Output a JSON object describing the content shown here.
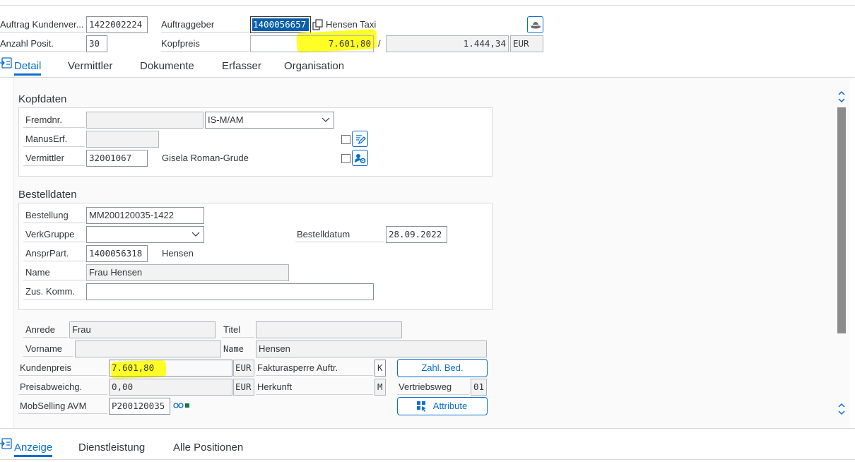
{
  "header": {
    "auftrag_label": "Auftrag Kundenver...",
    "auftrag_value": "1422002224",
    "auftraggeber_label": "Auftraggeber",
    "auftraggeber_value": "1400056657",
    "auftraggeber_name": "Hensen Taxi",
    "anzahl_label": "Anzahl Posit.",
    "anzahl_value": "30",
    "kopfpreis_label": "Kopfpreis",
    "kopfpreis_value": "7.601,80",
    "separator": "/",
    "kopfpreis2_value": "1.444,34",
    "currency": "EUR"
  },
  "tabs_top": [
    {
      "label": "Detail"
    },
    {
      "label": "Vermittler"
    },
    {
      "label": "Dokumente"
    },
    {
      "label": "Erfasser"
    },
    {
      "label": "Organisation"
    }
  ],
  "kopfdaten": {
    "title": "Kopfdaten",
    "fremdnr_label": "Fremdnr.",
    "fremdnr_value": "",
    "fremdnr_select": "IS-M/AM",
    "manuserf_label": "ManusErf.",
    "manuserf_value": "",
    "vermittler_label": "Vermittler",
    "vermittler_value": "32001067",
    "vermittler_name": "Gisela Roman-Grude"
  },
  "bestelldaten": {
    "title": "Bestelldaten",
    "bestellung_label": "Bestellung",
    "bestellung_value": "MM200120035-1422",
    "verkgruppe_label": "VerkGruppe",
    "verkgruppe_value": "",
    "bestelldatum_label": "Bestelldatum",
    "bestelldatum_value": "28.09.2022",
    "ansprpart_label": "AnsprPart.",
    "ansprpart_value": "1400056318",
    "ansprpart_name": "Hensen",
    "name_label": "Name",
    "name_value": "Frau Hensen",
    "zuskomm_label": "Zus. Komm.",
    "zuskomm_value": ""
  },
  "personal": {
    "anrede_label": "Anrede",
    "anrede_value": "Frau",
    "titel_label": "Titel",
    "titel_value": "",
    "vorname_label": "Vorname",
    "vorname_value": "",
    "name_label": "Name",
    "name_value": "Hensen",
    "kundenpreis_label": "Kundenpreis",
    "kundenpreis_value": "7.601,80",
    "kundenpreis_currency": "EUR",
    "fakturasperre_label": "Fakturasperre Auftr.",
    "fakturasperre_value": "K",
    "zahl_button": "Zahl. Bed.",
    "preisabw_label": "Preisabweichg.",
    "preisabw_value": "0,00",
    "preisabw_currency": "EUR",
    "herkunft_label": "Herkunft",
    "herkunft_value": "M",
    "vertriebsweg_label": "Vertriebsweg",
    "vertriebsweg_value": "01",
    "mobselling_label": "MobSelling AVM",
    "mobselling_value": "P200120035",
    "attribute_button": "Attribute"
  },
  "tabs_bottom": [
    {
      "label": "Anzeige"
    },
    {
      "label": "Dienstleistung"
    },
    {
      "label": "Alle Positionen"
    }
  ],
  "colors": {
    "accent": "#0a6ed1",
    "highlight": "#ffff00",
    "selection": "#0a5da8"
  },
  "icons": [
    "hat-icon",
    "copy-icon",
    "collapse-icon",
    "edit-note-icon",
    "settings-person-icon",
    "attribute-icon",
    "scroll-up-icon",
    "scroll-down-icon",
    "link-status-icon",
    "chevron-down-icon"
  ]
}
